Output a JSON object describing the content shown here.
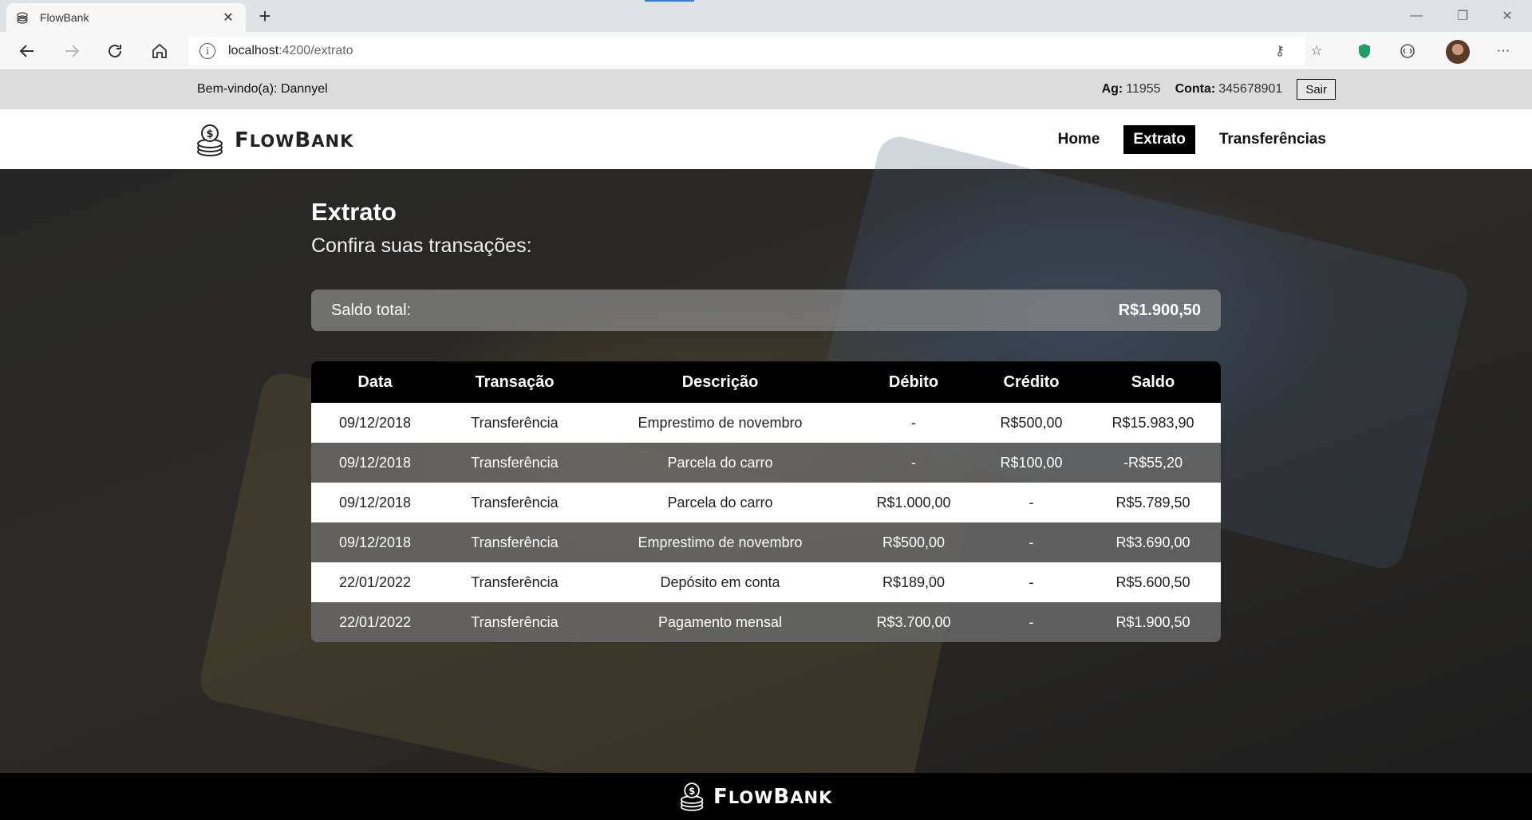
{
  "browser": {
    "tab_title": "FlowBank",
    "url_host": "localhost",
    "url_path": ":4200/extrato"
  },
  "infobar": {
    "welcome_label": "Bem-vindo(a):",
    "user_name": "Dannyel",
    "agency_label": "Ag:",
    "agency_value": "11955",
    "account_label": "Conta:",
    "account_value": "345678901",
    "logout_label": "Sair"
  },
  "header": {
    "logo_first": "F",
    "logo_rest": "LOW",
    "logo_second": "B",
    "logo_second_rest": "ANK",
    "nav": [
      {
        "label": "Home"
      },
      {
        "label": "Extrato"
      },
      {
        "label": "Transferências"
      }
    ]
  },
  "main": {
    "title": "Extrato",
    "subtitle": "Confira suas transações:",
    "balance_label": "Saldo total:",
    "balance_value": "R$1.900,50"
  },
  "table": {
    "columns": [
      "Data",
      "Transação",
      "Descrição",
      "Débito",
      "Crédito",
      "Saldo"
    ],
    "rows": [
      [
        "09/12/2018",
        "Transferência",
        "Emprestimo de novembro",
        "-",
        "R$500,00",
        "R$15.983,90"
      ],
      [
        "09/12/2018",
        "Transferência",
        "Parcela do carro",
        "-",
        "R$100,00",
        "-R$55,20"
      ],
      [
        "09/12/2018",
        "Transferência",
        "Parcela do carro",
        "R$1.000,00",
        "-",
        "R$5.789,50"
      ],
      [
        "09/12/2018",
        "Transferência",
        "Emprestimo de novembro",
        "R$500,00",
        "-",
        "R$3.690,00"
      ],
      [
        "22/01/2022",
        "Transferência",
        "Depósito em conta",
        "R$189,00",
        "-",
        "R$5.600,50"
      ],
      [
        "22/01/2022",
        "Transferência",
        "Pagamento mensal",
        "R$3.700,00",
        "-",
        "R$1.900,50"
      ]
    ]
  },
  "colors": {
    "nav_active_bg": "#000000",
    "footer_bg": "#000000",
    "infobar_bg": "#dcdcdc"
  }
}
